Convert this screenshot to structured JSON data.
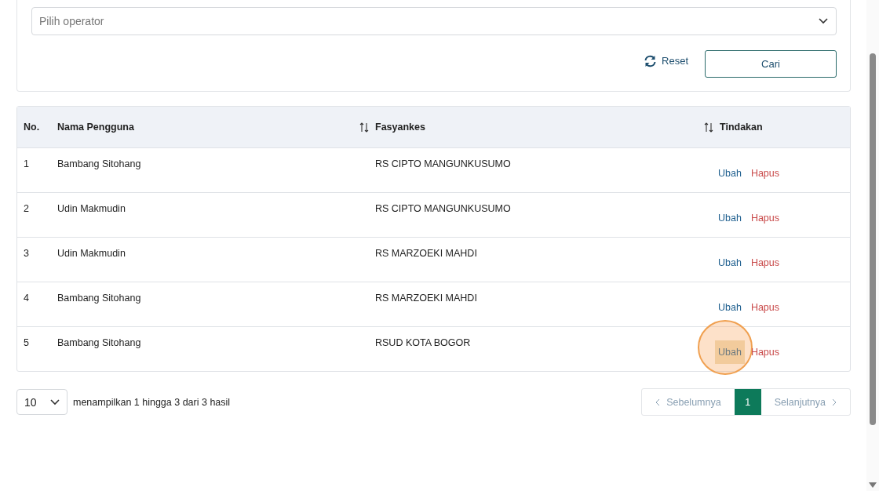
{
  "filter": {
    "placeholder": "Pilih operator",
    "reset_label": "Reset",
    "search_label": "Cari"
  },
  "table": {
    "columns": [
      {
        "label": "No.",
        "sortable": false
      },
      {
        "label": "Nama Pengguna",
        "sortable": true
      },
      {
        "label": "Fasyankes",
        "sortable": true
      },
      {
        "label": "Tindakan",
        "sortable": false
      }
    ],
    "rows": [
      {
        "no": "1",
        "name": "Bambang Sitohang",
        "facility": "RS CIPTO MANGUNKUSUMO",
        "edit": "Ubah",
        "delete": "Hapus",
        "highlighted": false
      },
      {
        "no": "2",
        "name": "Udin Makmudin",
        "facility": "RS CIPTO MANGUNKUSUMO",
        "edit": "Ubah",
        "delete": "Hapus",
        "highlighted": false
      },
      {
        "no": "3",
        "name": "Udin Makmudin",
        "facility": "RS MARZOEKI MAHDI",
        "edit": "Ubah",
        "delete": "Hapus",
        "highlighted": false
      },
      {
        "no": "4",
        "name": "Bambang Sitohang",
        "facility": "RS MARZOEKI MAHDI",
        "edit": "Ubah",
        "delete": "Hapus",
        "highlighted": false
      },
      {
        "no": "5",
        "name": "Bambang Sitohang",
        "facility": "RSUD KOTA BOGOR",
        "edit": "Ubah",
        "delete": "Hapus",
        "highlighted": true
      }
    ]
  },
  "footer": {
    "page_size": "10",
    "summary": "menampilkan 1 hingga 3 dari 3 hasil",
    "prev": "Sebelumnya",
    "next": "Selanjutnya",
    "pages": [
      {
        "label": "1",
        "selected": true
      }
    ]
  }
}
